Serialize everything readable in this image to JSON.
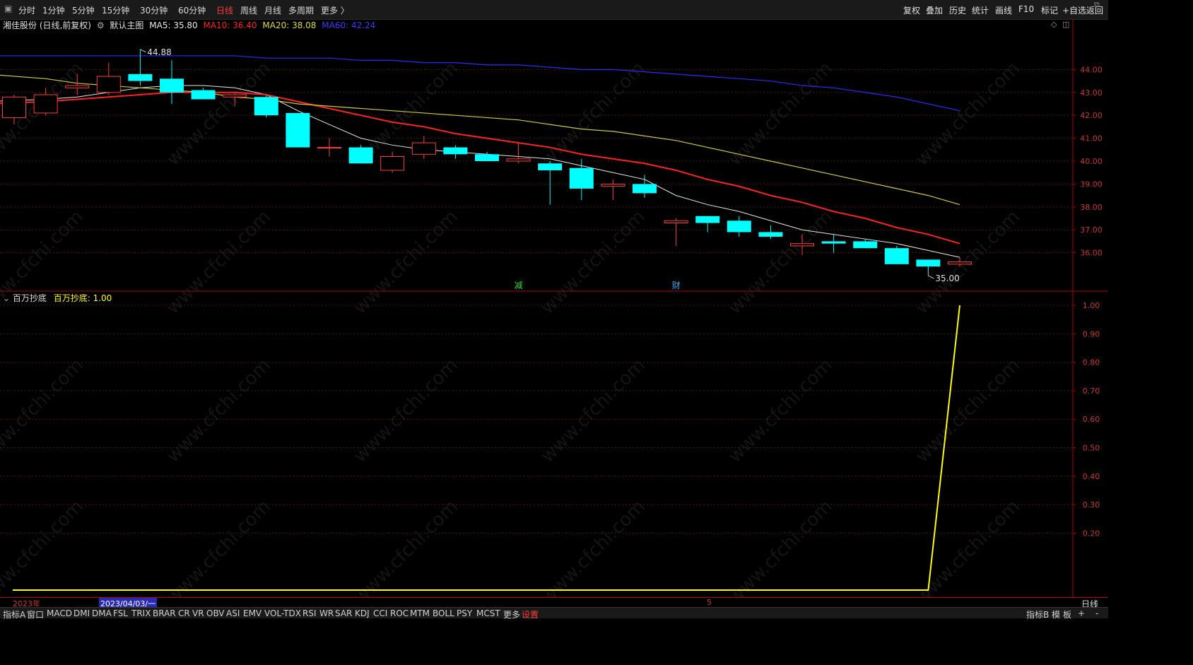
{
  "toolbar": {
    "periods": [
      "分时",
      "1分钟",
      "5分钟",
      "15分钟",
      "30分钟",
      "60分钟",
      "日线",
      "周线",
      "月线",
      "多周期",
      "更多 〉"
    ],
    "active_period": "日线",
    "right_items": [
      "复权",
      "叠加",
      "历史",
      "统计",
      "画线",
      "F10",
      "标记",
      "+自选",
      "返回"
    ]
  },
  "main_chart": {
    "stock_title": "湘佳股份 (日线,前复权)",
    "template": "默认主图",
    "ma5_label": "MA5: 35.80",
    "ma10_label": "MA10: 36.40",
    "ma20_label": "MA20: 38.08",
    "ma60_label": "MA60: 42.24",
    "high_marker": "44.88",
    "low_marker": "35.00",
    "event_marks": [
      "减",
      "财"
    ]
  },
  "sub_chart": {
    "indicator_name": "百万抄底",
    "value_label": "百万抄底: 1.00"
  },
  "date_axis": {
    "year_label": "2023年",
    "cursor_date": "2023/04/03/一",
    "month_label": "5"
  },
  "right_period": "日线",
  "bottom_bar": {
    "left_items": [
      "指标A",
      "窗口",
      "MACD",
      "DMI",
      "DMA",
      "FSL",
      "TRIX",
      "BRAR",
      "CR",
      "VR",
      "OBV",
      "ASI",
      "EMV",
      "VOL-TDX",
      "RSI",
      "WR",
      "SAR",
      "KDJ",
      "CCI",
      "ROC",
      "MTM",
      "BOLL",
      "PSY",
      "MCST",
      "更多",
      "设置"
    ],
    "right_items": [
      "指标B",
      "模",
      "板",
      "+",
      "-"
    ]
  },
  "watermark": "www.cfchi.com",
  "colors": {
    "up": "#ff3b3b",
    "down": "#00ffff",
    "ma5": "#e8e8e8",
    "ma10": "#ff2020",
    "ma20": "#cccc33",
    "ma60": "#2a2aff",
    "indicator": "#ffff00",
    "axis": "#b00000"
  },
  "chart_data": [
    {
      "type": "candlestick",
      "title": "湘佳股份 (日线,前复权)",
      "ylim": [
        35.0,
        45.0
      ],
      "y_ticks": [
        36.0,
        37.0,
        38.0,
        39.0,
        40.0,
        41.0,
        42.0,
        43.0,
        44.0
      ],
      "candles": [
        {
          "open": 41.9,
          "close": 42.8,
          "high": 42.9,
          "low": 41.6
        },
        {
          "open": 42.1,
          "close": 42.9,
          "high": 43.2,
          "low": 42.0
        },
        {
          "open": 43.2,
          "close": 43.3,
          "high": 43.8,
          "low": 42.9
        },
        {
          "open": 43.0,
          "close": 43.7,
          "high": 44.3,
          "low": 42.9
        },
        {
          "open": 43.8,
          "close": 43.5,
          "high": 44.88,
          "low": 43.3
        },
        {
          "open": 43.6,
          "close": 43.0,
          "high": 44.4,
          "low": 42.5
        },
        {
          "open": 43.1,
          "close": 42.7,
          "high": 43.2,
          "low": 42.7
        },
        {
          "open": 42.8,
          "close": 42.9,
          "high": 43.0,
          "low": 42.4
        },
        {
          "open": 42.8,
          "close": 42.0,
          "high": 42.9,
          "low": 41.9
        },
        {
          "open": 42.1,
          "close": 40.6,
          "high": 42.1,
          "low": 40.6
        },
        {
          "open": 40.6,
          "close": 40.6,
          "high": 41.0,
          "low": 40.2
        },
        {
          "open": 40.6,
          "close": 39.9,
          "high": 40.7,
          "low": 39.9
        },
        {
          "open": 39.6,
          "close": 40.2,
          "high": 40.4,
          "low": 39.5
        },
        {
          "open": 40.3,
          "close": 40.8,
          "high": 41.1,
          "low": 40.1
        },
        {
          "open": 40.6,
          "close": 40.3,
          "high": 40.7,
          "low": 40.1
        },
        {
          "open": 40.3,
          "close": 40.0,
          "high": 40.4,
          "low": 40.0
        },
        {
          "open": 40.0,
          "close": 40.1,
          "high": 40.8,
          "low": 39.9
        },
        {
          "open": 39.9,
          "close": 39.6,
          "high": 40.0,
          "low": 38.1
        },
        {
          "open": 39.7,
          "close": 38.8,
          "high": 40.1,
          "low": 38.3
        },
        {
          "open": 38.9,
          "close": 39.0,
          "high": 39.2,
          "low": 38.3
        },
        {
          "open": 39.0,
          "close": 38.6,
          "high": 39.4,
          "low": 38.4
        },
        {
          "open": 37.3,
          "close": 37.4,
          "high": 37.5,
          "low": 36.3
        },
        {
          "open": 37.6,
          "close": 37.3,
          "high": 37.6,
          "low": 36.9
        },
        {
          "open": 37.4,
          "close": 36.9,
          "high": 37.6,
          "low": 36.7
        },
        {
          "open": 36.9,
          "close": 36.7,
          "high": 37.2,
          "low": 36.6
        },
        {
          "open": 36.3,
          "close": 36.4,
          "high": 36.8,
          "low": 35.9
        },
        {
          "open": 36.5,
          "close": 36.4,
          "high": 36.8,
          "low": 36.0
        },
        {
          "open": 36.5,
          "close": 36.2,
          "high": 36.6,
          "low": 36.2
        },
        {
          "open": 36.2,
          "close": 35.5,
          "high": 36.3,
          "low": 35.5
        },
        {
          "open": 35.7,
          "close": 35.4,
          "high": 35.7,
          "low": 35.0
        },
        {
          "open": 35.5,
          "close": 35.6,
          "high": 35.8,
          "low": 35.4
        }
      ],
      "series": [
        {
          "name": "MA5",
          "values": [
            42.6,
            42.7,
            42.8,
            43.0,
            43.2,
            43.3,
            43.3,
            43.2,
            42.9,
            42.2,
            41.6,
            41.0,
            40.7,
            40.5,
            40.4,
            40.3,
            40.2,
            40.1,
            39.8,
            39.5,
            39.2,
            38.5,
            38.1,
            37.8,
            37.4,
            37.0,
            36.8,
            36.6,
            36.4,
            36.1,
            35.8
          ]
        },
        {
          "name": "MA10",
          "values": [
            42.5,
            42.6,
            42.7,
            42.8,
            42.9,
            43.0,
            43.0,
            43.0,
            42.9,
            42.6,
            42.3,
            42.0,
            41.7,
            41.5,
            41.2,
            41.0,
            40.8,
            40.6,
            40.3,
            40.1,
            39.9,
            39.6,
            39.2,
            38.9,
            38.5,
            38.2,
            37.8,
            37.5,
            37.1,
            36.8,
            36.4
          ]
        },
        {
          "name": "MA20",
          "values": [
            43.8,
            43.6,
            43.4,
            43.3,
            43.2,
            43.1,
            43.0,
            42.8,
            42.7,
            42.5,
            42.4,
            42.3,
            42.2,
            42.1,
            42.0,
            41.9,
            41.8,
            41.6,
            41.4,
            41.3,
            41.1,
            40.9,
            40.6,
            40.3,
            40.0,
            39.7,
            39.4,
            39.1,
            38.8,
            38.5,
            38.1
          ]
        },
        {
          "name": "MA60",
          "values": [
            44.6,
            44.6,
            44.6,
            44.6,
            44.6,
            44.6,
            44.6,
            44.6,
            44.5,
            44.5,
            44.5,
            44.4,
            44.4,
            44.3,
            44.3,
            44.2,
            44.2,
            44.1,
            44.0,
            44.0,
            43.9,
            43.8,
            43.7,
            43.6,
            43.5,
            43.3,
            43.2,
            43.0,
            42.8,
            42.5,
            42.2
          ]
        }
      ]
    },
    {
      "type": "line",
      "title": "百万抄底",
      "ylim": [
        0.0,
        1.0
      ],
      "y_ticks": [
        0.2,
        0.3,
        0.4,
        0.5,
        0.6,
        0.7,
        0.8,
        0.9,
        1.0
      ],
      "series": [
        {
          "name": "百万抄底",
          "values": [
            0,
            0,
            0,
            0,
            0,
            0,
            0,
            0,
            0,
            0,
            0,
            0,
            0,
            0,
            0,
            0,
            0,
            0,
            0,
            0,
            0,
            0,
            0,
            0,
            0,
            0,
            0,
            0,
            0,
            0,
            1.0
          ]
        }
      ]
    }
  ]
}
